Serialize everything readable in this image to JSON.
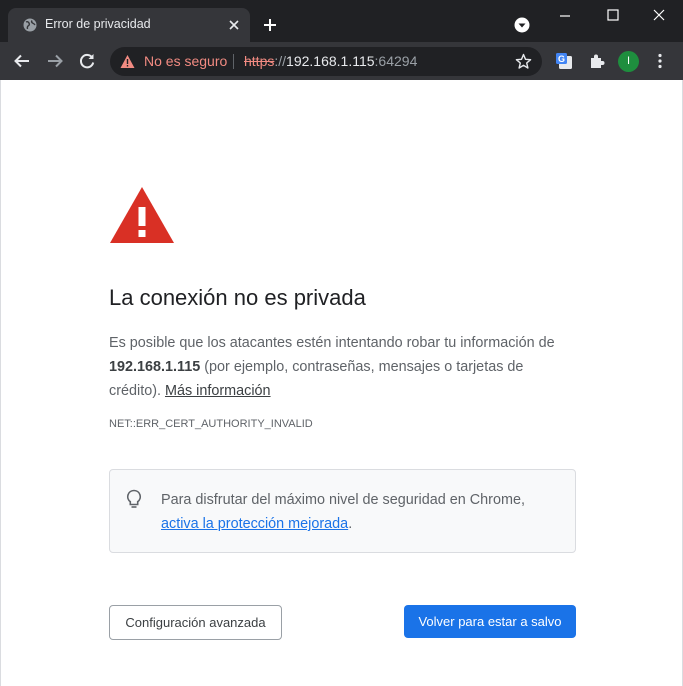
{
  "tab": {
    "title": "Error de privacidad"
  },
  "omnibox": {
    "security_label": "No es seguro",
    "url_scheme": "https",
    "url_sep": "://",
    "url_host": "192.168.1.115",
    "url_port": ":64294"
  },
  "profile": {
    "initial": "I"
  },
  "page": {
    "heading": "La conexión no es privada",
    "desc_before": "Es posible que los atacantes estén intentando robar tu información de ",
    "desc_host": "192.168.1.115",
    "desc_after": " (por ejemplo, contraseñas, mensajes o tarjetas de crédito). ",
    "more_info_link": "Más información",
    "error_code": "NET::ERR_CERT_AUTHORITY_INVALID",
    "info_text": "Para disfrutar del máximo nivel de seguridad en Chrome, ",
    "info_link": "activa la protección mejorada",
    "info_end": ".",
    "advanced_button": "Configuración avanzada",
    "back_button": "Volver para estar a salvo"
  },
  "colors": {
    "titlebar": "#202124",
    "toolbar": "#35363a",
    "insecure": "#f28b82",
    "warning_red": "#d93025",
    "primary_blue": "#1a73e8"
  },
  "icons": [
    "globe-icon",
    "close-icon",
    "plus-icon",
    "tab-search-icon",
    "minimize-icon",
    "maximize-icon",
    "back-arrow-icon",
    "forward-arrow-icon",
    "reload-icon",
    "warning-icon",
    "star-icon",
    "translate-icon",
    "puzzle-icon",
    "menu-icon",
    "lightbulb-icon"
  ]
}
